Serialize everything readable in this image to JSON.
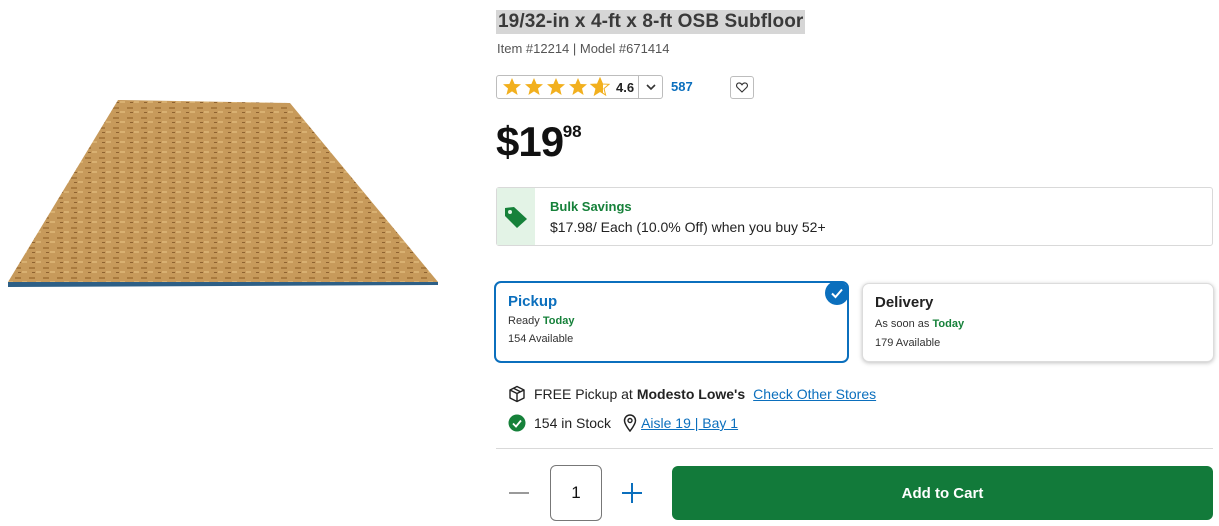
{
  "product": {
    "title": "19/32-in x 4-ft x 8-ft OSB Subfloor",
    "item_line": "Item #12214 | Model #671414",
    "rating": "4.6",
    "review_count": "587",
    "price_dollars": "$19",
    "price_cents": ".98"
  },
  "bulk": {
    "title": "Bulk Savings",
    "description": "$17.98/ Each (10.0% Off) when you buy 52+",
    "icon": "price-tag-icon"
  },
  "pickup": {
    "title": "Pickup",
    "ready_prefix": "Ready ",
    "ready_when": "Today",
    "available": "154 Available"
  },
  "delivery": {
    "title": "Delivery",
    "eta_prefix": "As soon as ",
    "eta_when": "Today",
    "available": "179 Available"
  },
  "store": {
    "pickup_prefix": "FREE Pickup at",
    "store_name": "Modesto Lowe's",
    "check_other": "Check Other Stores",
    "stock": "154 in Stock",
    "aisle": "Aisle 19 | Bay 1"
  },
  "cart": {
    "quantity": "1",
    "add_label": "Add to Cart"
  },
  "colors": {
    "brand_blue": "#0b6fbd",
    "brand_green": "#127a3a",
    "star_gold": "#f2b01e"
  }
}
